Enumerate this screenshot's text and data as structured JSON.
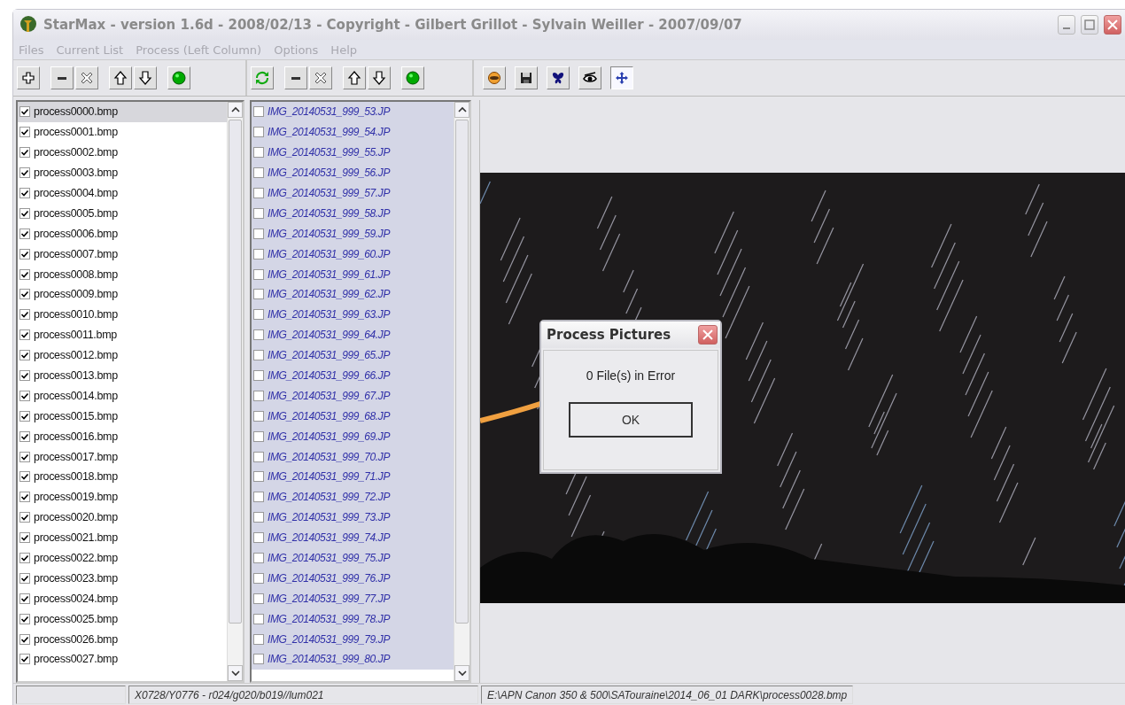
{
  "window": {
    "title": "StarMax - version 1.6d - 2008/02/13 - Copyright - Gilbert Grillot - Sylvain Weiller - 2007/09/07"
  },
  "menu": [
    "Files",
    "Current List",
    "Process (Left Column)",
    "Options",
    "Help"
  ],
  "left_toolbar": [
    {
      "kind": "plus"
    },
    {
      "kind": "minus"
    },
    {
      "kind": "clear"
    },
    {
      "kind": "up"
    },
    {
      "kind": "down"
    },
    {
      "kind": "go"
    }
  ],
  "middle_toolbar": [
    {
      "kind": "refresh"
    },
    {
      "kind": "minus"
    },
    {
      "kind": "clear"
    },
    {
      "kind": "up"
    },
    {
      "kind": "down"
    },
    {
      "kind": "go"
    }
  ],
  "viewer_toolbar": [
    {
      "kind": "face",
      "pressed": false
    },
    {
      "kind": "save",
      "pressed": false
    },
    {
      "kind": "butterfly",
      "pressed": false
    },
    {
      "kind": "eye",
      "pressed": false
    },
    {
      "kind": "move",
      "pressed": true
    }
  ],
  "left_list": [
    {
      "name": "process0000.bmp",
      "checked": true,
      "selected": true
    },
    {
      "name": "process0001.bmp",
      "checked": true,
      "selected": false
    },
    {
      "name": "process0002.bmp",
      "checked": true,
      "selected": false
    },
    {
      "name": "process0003.bmp",
      "checked": true,
      "selected": false
    },
    {
      "name": "process0004.bmp",
      "checked": true,
      "selected": false
    },
    {
      "name": "process0005.bmp",
      "checked": true,
      "selected": false
    },
    {
      "name": "process0006.bmp",
      "checked": true,
      "selected": false
    },
    {
      "name": "process0007.bmp",
      "checked": true,
      "selected": false
    },
    {
      "name": "process0008.bmp",
      "checked": true,
      "selected": false
    },
    {
      "name": "process0009.bmp",
      "checked": true,
      "selected": false
    },
    {
      "name": "process0010.bmp",
      "checked": true,
      "selected": false
    },
    {
      "name": "process0011.bmp",
      "checked": true,
      "selected": false
    },
    {
      "name": "process0012.bmp",
      "checked": true,
      "selected": false
    },
    {
      "name": "process0013.bmp",
      "checked": true,
      "selected": false
    },
    {
      "name": "process0014.bmp",
      "checked": true,
      "selected": false
    },
    {
      "name": "process0015.bmp",
      "checked": true,
      "selected": false
    },
    {
      "name": "process0016.bmp",
      "checked": true,
      "selected": false
    },
    {
      "name": "process0017.bmp",
      "checked": true,
      "selected": false
    },
    {
      "name": "process0018.bmp",
      "checked": true,
      "selected": false
    },
    {
      "name": "process0019.bmp",
      "checked": true,
      "selected": false
    },
    {
      "name": "process0020.bmp",
      "checked": true,
      "selected": false
    },
    {
      "name": "process0021.bmp",
      "checked": true,
      "selected": false
    },
    {
      "name": "process0022.bmp",
      "checked": true,
      "selected": false
    },
    {
      "name": "process0023.bmp",
      "checked": true,
      "selected": false
    },
    {
      "name": "process0024.bmp",
      "checked": true,
      "selected": false
    },
    {
      "name": "process0025.bmp",
      "checked": true,
      "selected": false
    },
    {
      "name": "process0026.bmp",
      "checked": true,
      "selected": false
    },
    {
      "name": "process0027.bmp",
      "checked": true,
      "selected": false
    }
  ],
  "middle_list": [
    {
      "name": "IMG_20140531_999_53.JP",
      "checked": false,
      "selected": true
    },
    {
      "name": "IMG_20140531_999_54.JP",
      "checked": false,
      "selected": true
    },
    {
      "name": "IMG_20140531_999_55.JP",
      "checked": false,
      "selected": true
    },
    {
      "name": "IMG_20140531_999_56.JP",
      "checked": false,
      "selected": true
    },
    {
      "name": "IMG_20140531_999_57.JP",
      "checked": false,
      "selected": true
    },
    {
      "name": "IMG_20140531_999_58.JP",
      "checked": false,
      "selected": true
    },
    {
      "name": "IMG_20140531_999_59.JP",
      "checked": false,
      "selected": true
    },
    {
      "name": "IMG_20140531_999_60.JP",
      "checked": false,
      "selected": true
    },
    {
      "name": "IMG_20140531_999_61.JP",
      "checked": false,
      "selected": true
    },
    {
      "name": "IMG_20140531_999_62.JP",
      "checked": false,
      "selected": true
    },
    {
      "name": "IMG_20140531_999_63.JP",
      "checked": false,
      "selected": true
    },
    {
      "name": "IMG_20140531_999_64.JP",
      "checked": false,
      "selected": true
    },
    {
      "name": "IMG_20140531_999_65.JP",
      "checked": false,
      "selected": true
    },
    {
      "name": "IMG_20140531_999_66.JP",
      "checked": false,
      "selected": true
    },
    {
      "name": "IMG_20140531_999_67.JP",
      "checked": false,
      "selected": true
    },
    {
      "name": "IMG_20140531_999_68.JP",
      "checked": false,
      "selected": true
    },
    {
      "name": "IMG_20140531_999_69.JP",
      "checked": false,
      "selected": true
    },
    {
      "name": "IMG_20140531_999_70.JP",
      "checked": false,
      "selected": true
    },
    {
      "name": "IMG_20140531_999_71.JP",
      "checked": false,
      "selected": true
    },
    {
      "name": "IMG_20140531_999_72.JP",
      "checked": false,
      "selected": true
    },
    {
      "name": "IMG_20140531_999_73.JP",
      "checked": false,
      "selected": true
    },
    {
      "name": "IMG_20140531_999_74.JP",
      "checked": false,
      "selected": true
    },
    {
      "name": "IMG_20140531_999_75.JP",
      "checked": false,
      "selected": true
    },
    {
      "name": "IMG_20140531_999_76.JP",
      "checked": false,
      "selected": true
    },
    {
      "name": "IMG_20140531_999_77.JP",
      "checked": false,
      "selected": true
    },
    {
      "name": "IMG_20140531_999_78.JP",
      "checked": false,
      "selected": true
    },
    {
      "name": "IMG_20140531_999_79.JP",
      "checked": false,
      "selected": true
    },
    {
      "name": "IMG_20140531_999_80.JP",
      "checked": false,
      "selected": true
    }
  ],
  "dialog": {
    "title": "Process Pictures",
    "message": "0 File(s) in Error",
    "button": "OK"
  },
  "status_bar": {
    "pixel": "X0728/Y0776 - r024/g020/b019//lum021",
    "path": "E:\\APN Canon 350 & 500\\SATouraine\\2014_06_01 DARK\\process0028.bmp"
  }
}
